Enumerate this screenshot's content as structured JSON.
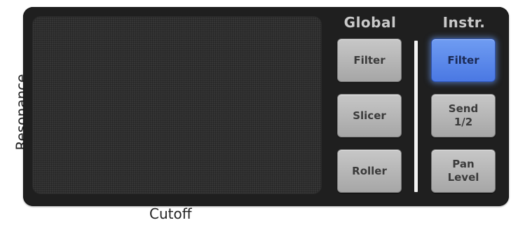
{
  "axes": {
    "x_label": "Cutoff",
    "y_label": "Resonance"
  },
  "global": {
    "title": "Global",
    "buttons": [
      {
        "label": "Filter",
        "active": false
      },
      {
        "label": "Slicer",
        "active": false
      },
      {
        "label": "Roller",
        "active": false
      }
    ]
  },
  "instrument": {
    "title": "Instr.",
    "buttons": [
      {
        "label": "Filter",
        "active": true
      },
      {
        "label": "Send\n1/2",
        "active": false
      },
      {
        "label": "Pan\nLevel",
        "active": false
      }
    ]
  },
  "colors": {
    "panel": "#1f1f1f",
    "pad": "#353535",
    "button": "#b8b8b8",
    "active_button": "#5a88ee"
  }
}
